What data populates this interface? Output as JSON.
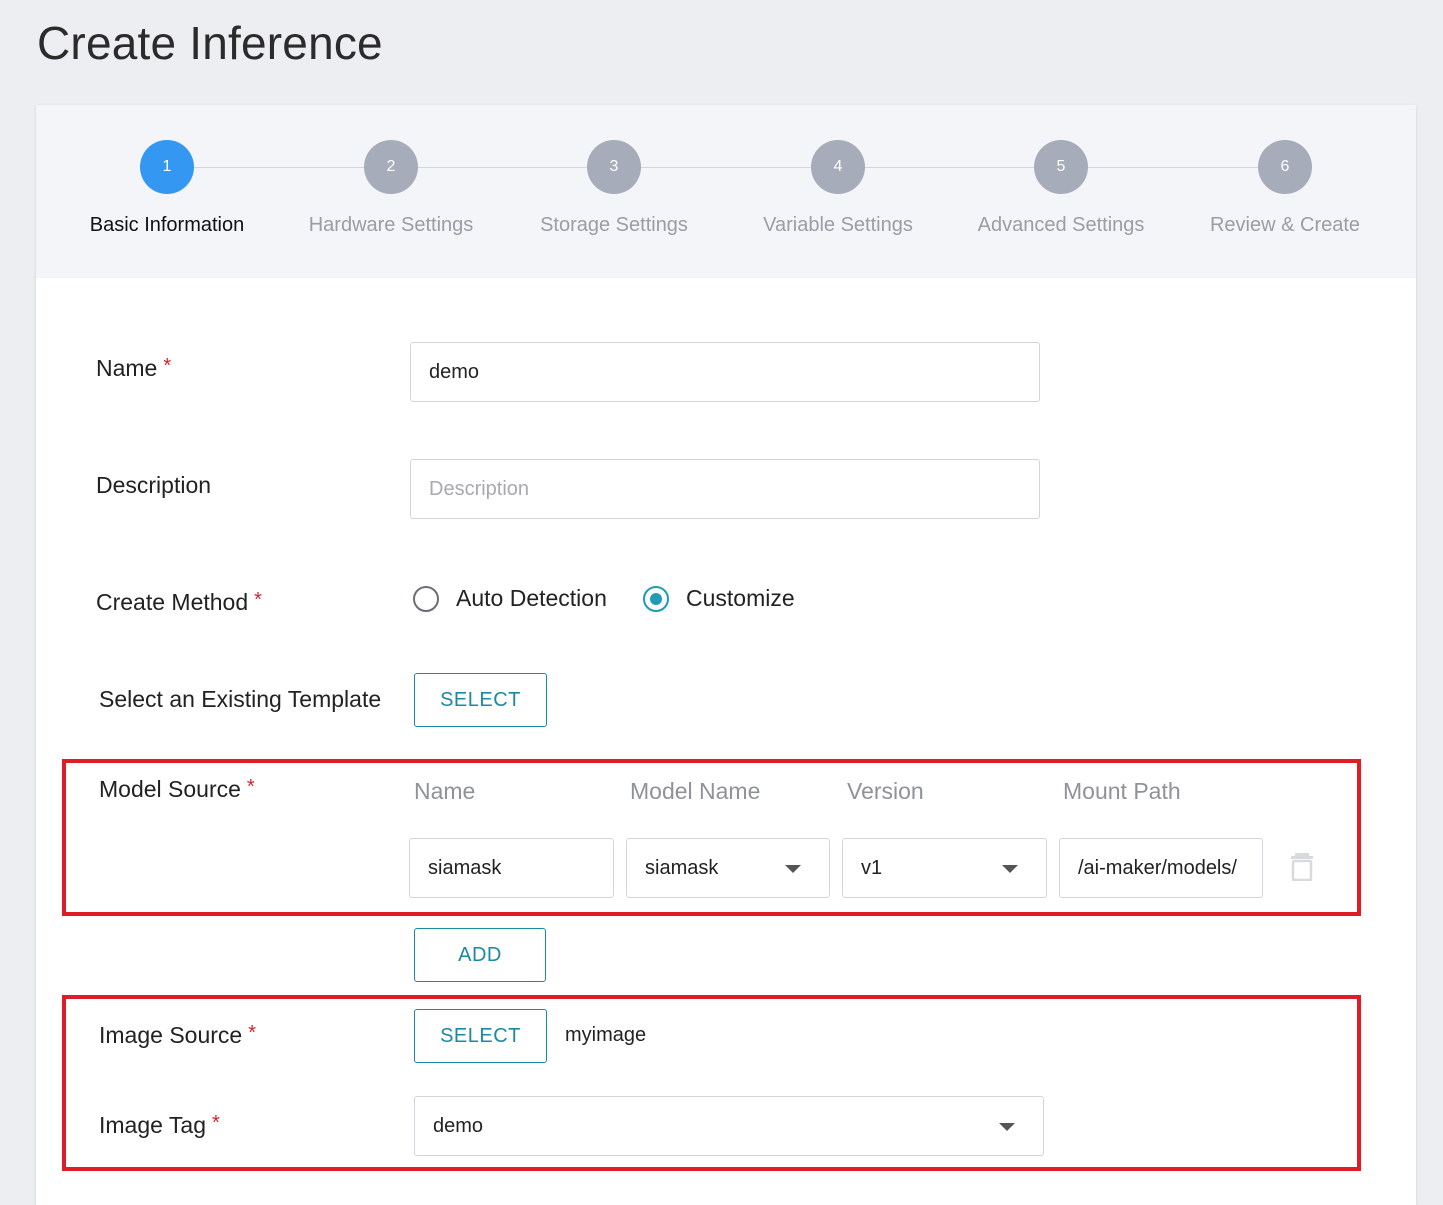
{
  "page": {
    "title": "Create Inference"
  },
  "stepper": {
    "steps": [
      {
        "number": "1",
        "label": "Basic Information",
        "active": true
      },
      {
        "number": "2",
        "label": "Hardware Settings",
        "active": false
      },
      {
        "number": "3",
        "label": "Storage Settings",
        "active": false
      },
      {
        "number": "4",
        "label": "Variable Settings",
        "active": false
      },
      {
        "number": "5",
        "label": "Advanced Settings",
        "active": false
      },
      {
        "number": "6",
        "label": "Review & Create",
        "active": false
      }
    ]
  },
  "form": {
    "required_mark": "*",
    "name": {
      "label": "Name",
      "value": "demo"
    },
    "description": {
      "label": "Description",
      "value": "",
      "placeholder": "Description"
    },
    "create_method": {
      "label": "Create Method",
      "options": [
        "Auto Detection",
        "Customize"
      ],
      "selected": "Customize"
    },
    "template": {
      "label": "Select an Existing Template",
      "button_label": "SELECT"
    },
    "model_source": {
      "label": "Model Source",
      "columns": [
        "Name",
        "Model Name",
        "Version",
        "Mount Path"
      ],
      "rows": [
        {
          "name": "siamask",
          "model_name": "siamask",
          "version": "v1",
          "mount_path": "/ai-maker/models/"
        }
      ],
      "add_button_label": "ADD"
    },
    "image_source": {
      "label": "Image Source",
      "button_label": "SELECT",
      "value": "myimage"
    },
    "image_tag": {
      "label": "Image Tag",
      "value": "demo"
    }
  },
  "colors": {
    "active_step": "#3498f3",
    "inactive_step": "#a7acbb",
    "accent": "#1a8aa3",
    "radio_checked": "#1d9cb5",
    "required": "#d0232a",
    "highlight_border": "#e01d27"
  },
  "icons": {
    "delete_row": "trash-icon",
    "dropdown": "caret-down-icon"
  }
}
